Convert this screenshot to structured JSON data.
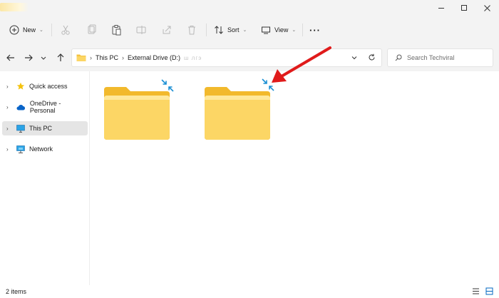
{
  "toolbar": {
    "new_label": "New",
    "sort_label": "Sort",
    "view_label": "View",
    "more_label": "···"
  },
  "address": {
    "crumbs": [
      "This PC",
      "External Drive (D:)"
    ],
    "blurred_crumb": "ш лгэ"
  },
  "search": {
    "placeholder": "Search Techviral"
  },
  "sidebar": {
    "items": [
      {
        "label": "Quick access",
        "icon": "star-icon"
      },
      {
        "label": "OneDrive - Personal",
        "icon": "cloud-icon"
      },
      {
        "label": "This PC",
        "icon": "monitor-icon",
        "selected": true
      },
      {
        "label": "Network",
        "icon": "network-icon"
      }
    ]
  },
  "status": {
    "item_count": "2 items"
  },
  "colors": {
    "folder_back": "#f2b92c",
    "folder_front": "#fcd665",
    "compress_blue": "#1a8fd4",
    "annotation_red": "#e01b1b",
    "accent": "#0067c0"
  }
}
